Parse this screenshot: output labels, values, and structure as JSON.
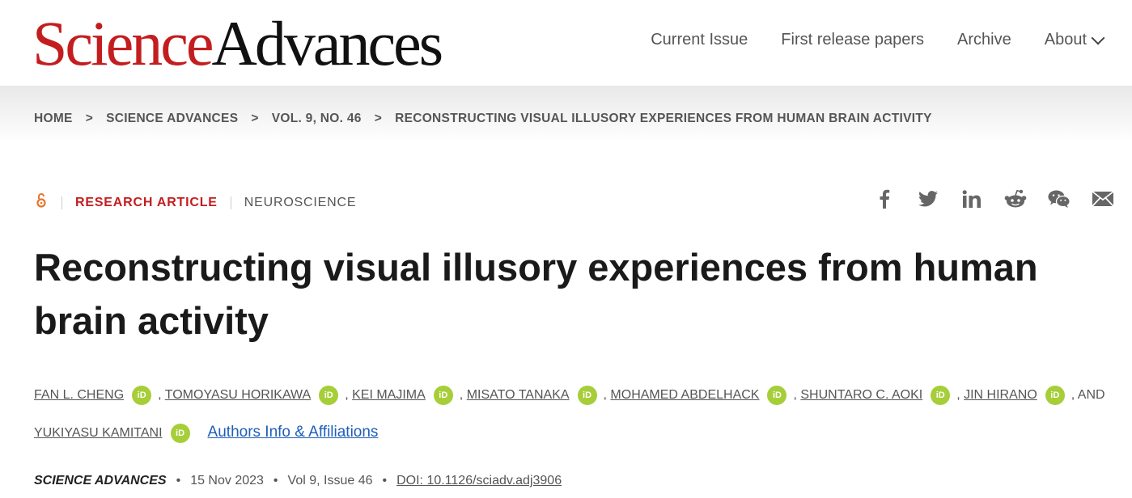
{
  "logo": {
    "part1": "Science",
    "part2": "Advances"
  },
  "nav": {
    "items": [
      "Current Issue",
      "First release papers",
      "Archive",
      "About"
    ]
  },
  "breadcrumbs": [
    "HOME",
    "SCIENCE ADVANCES",
    "VOL. 9, NO. 46",
    "RECONSTRUCTING VISUAL ILLUSORY EXPERIENCES FROM HUMAN BRAIN ACTIVITY"
  ],
  "article": {
    "type": "RESEARCH ARTICLE",
    "subject": "NEUROSCIENCE",
    "title": "Reconstructing visual illusory experiences from human brain activity",
    "authors": [
      "FAN L. CHENG",
      "TOMOYASU HORIKAWA",
      "KEI MAJIMA",
      "MISATO TANAKA",
      "MOHAMED ABDELHACK",
      "SHUNTARO C. AOKI",
      "JIN HIRANO",
      "YUKIYASU KAMITANI"
    ],
    "and_text": "AND",
    "orcid_label": "iD",
    "affiliations_link": "Authors Info & Affiliations"
  },
  "share": [
    "facebook-icon",
    "twitter-icon",
    "linkedin-icon",
    "reddit-icon",
    "wechat-icon",
    "email-icon"
  ],
  "footer": {
    "journal": "SCIENCE ADVANCES",
    "date": "15 Nov 2023",
    "volume": "Vol 9, Issue 46",
    "doi": "DOI: 10.1126/sciadv.adj3906",
    "dot": "•"
  },
  "colors": {
    "brand_red": "#c41d1f",
    "orcid_green": "#a6ce39",
    "link_blue": "#1f5fb8",
    "open_access_orange": "#e8742b"
  }
}
